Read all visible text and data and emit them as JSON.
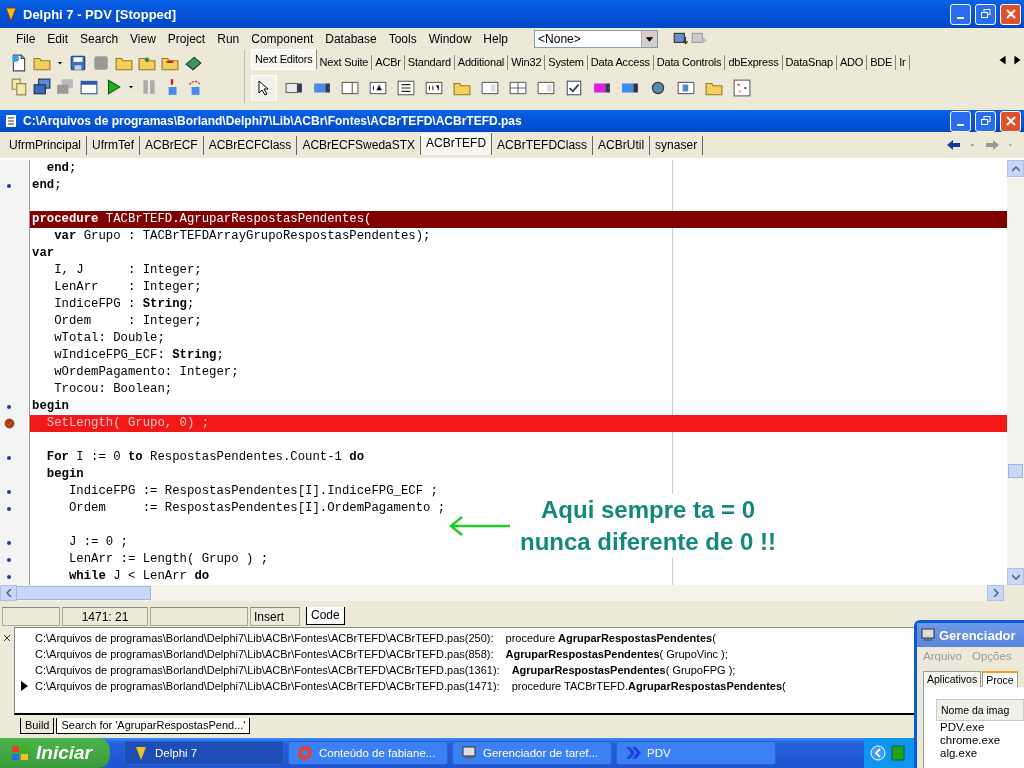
{
  "window": {
    "title": "Delphi 7 - PDV [Stopped]"
  },
  "menu": [
    "File",
    "Edit",
    "Search",
    "View",
    "Project",
    "Run",
    "Component",
    "Database",
    "Tools",
    "Window",
    "Help"
  ],
  "desktop_combo": {
    "value": "<None>"
  },
  "palette_tabs": [
    {
      "label": "Next Editors",
      "selected": true
    },
    {
      "label": "Next Suite",
      "selected": false
    },
    {
      "label": "ACBr",
      "selected": false
    },
    {
      "label": "Standard",
      "selected": false
    },
    {
      "label": "Additional",
      "selected": false
    },
    {
      "label": "Win32",
      "selected": false
    },
    {
      "label": "System",
      "selected": false
    },
    {
      "label": "Data Access",
      "selected": false
    },
    {
      "label": "Data Controls",
      "selected": false
    },
    {
      "label": "dbExpress",
      "selected": false
    },
    {
      "label": "DataSnap",
      "selected": false
    },
    {
      "label": "ADO",
      "selected": false
    },
    {
      "label": "BDE",
      "selected": false
    },
    {
      "label": "Ir",
      "selected": false
    }
  ],
  "editor": {
    "title": "C:\\Arquivos de programas\\Borland\\Delphi7\\Lib\\ACBr\\Fontes\\ACBrTEFD\\ACBrTEFD.pas",
    "tabs": [
      {
        "label": "UfrmPrincipal",
        "selected": false
      },
      {
        "label": "UfrmTef",
        "selected": false
      },
      {
        "label": "ACBrECF",
        "selected": false
      },
      {
        "label": "ACBrECFClass",
        "selected": false
      },
      {
        "label": "ACBrECFSwedaSTX",
        "selected": false
      },
      {
        "label": "ACBrTEFD",
        "selected": true
      },
      {
        "label": "ACBrTEFDClass",
        "selected": false
      },
      {
        "label": "ACBrUtil",
        "selected": false
      },
      {
        "label": "synaser",
        "selected": false
      }
    ],
    "lines": [
      {
        "kind": "plain",
        "text": "  **end**;",
        "dot": false
      },
      {
        "kind": "plain",
        "text": "**end**;",
        "dot": true
      },
      {
        "kind": "blank",
        "dot": false
      },
      {
        "kind": "search",
        "text": "**procedure** TACBrTEFD.AgruparRespostasPendentes(",
        "dot": false
      },
      {
        "kind": "plain",
        "text": "   **var** Grupo : TACBrTEFDArrayGrupoRespostasPendentes);",
        "dot": false
      },
      {
        "kind": "plain",
        "text": "**var**",
        "dot": false
      },
      {
        "kind": "plain",
        "text": "   I, J      : Integer;",
        "dot": false
      },
      {
        "kind": "plain",
        "text": "   LenArr    : Integer;",
        "dot": false
      },
      {
        "kind": "plain",
        "text": "   IndiceFPG : **String**;",
        "dot": false
      },
      {
        "kind": "plain",
        "text": "   Ordem     : Integer;",
        "dot": false
      },
      {
        "kind": "plain",
        "text": "   wTotal: Double;",
        "dot": false
      },
      {
        "kind": "plain",
        "text": "   wIndiceFPG_ECF: **String**;",
        "dot": false
      },
      {
        "kind": "plain",
        "text": "   wOrdemPagamento: Integer;",
        "dot": false
      },
      {
        "kind": "plain",
        "text": "   Trocou: Boolean;",
        "dot": false
      },
      {
        "kind": "plain",
        "text": "**begin**",
        "dot": true
      },
      {
        "kind": "breakpoint",
        "text": "  SetLength( Grupo, 0) ;",
        "dot": false
      },
      {
        "kind": "blank",
        "dot": false
      },
      {
        "kind": "plain",
        "text": "  **For** I := 0 **to** RespostasPendentes.Count-1 **do**",
        "dot": true
      },
      {
        "kind": "plain",
        "text": "  **begin**",
        "dot": false
      },
      {
        "kind": "plain",
        "text": "     IndiceFPG := RespostasPendentes[I].IndiceFPG_ECF ;",
        "dot": true
      },
      {
        "kind": "plain",
        "text": "     Ordem     := RespostasPendentes[I].OrdemPagamento ;",
        "dot": true
      },
      {
        "kind": "blank",
        "dot": false
      },
      {
        "kind": "plain",
        "text": "     J := 0 ;",
        "dot": true
      },
      {
        "kind": "plain",
        "text": "     LenArr := Length( Grupo ) ;",
        "dot": true
      },
      {
        "kind": "plain",
        "text": "     **while** J < LenArr **do**",
        "dot": true
      }
    ],
    "annotation": [
      "Aqui sempre ta = 0",
      "nunca diferente de 0 !!"
    ]
  },
  "status_bar": {
    "position": "1471:  21",
    "mode": "Insert",
    "tab": "Code"
  },
  "messages": {
    "rows": [
      {
        "location": "C:\\Arquivos de programas\\Borland\\Delphi7\\Lib\\ACBr\\Fontes\\ACBrTEFD\\ACBrTEFD.pas(250):",
        "match": "procedure **AgruparRespostasPendentes**(",
        "selected": false
      },
      {
        "location": "C:\\Arquivos de programas\\Borland\\Delphi7\\Lib\\ACBr\\Fontes\\ACBrTEFD\\ACBrTEFD.pas(858):",
        "match": "**AgruparRespostasPendentes**( GrupoVinc );",
        "selected": false
      },
      {
        "location": "C:\\Arquivos de programas\\Borland\\Delphi7\\Lib\\ACBr\\Fontes\\ACBrTEFD\\ACBrTEFD.pas(1361):",
        "match": "**AgruparRespostasPendentes**( GrupoFPG );",
        "selected": false
      },
      {
        "location": "C:\\Arquivos de programas\\Borland\\Delphi7\\Lib\\ACBr\\Fontes\\ACBrTEFD\\ACBrTEFD.pas(1471):",
        "match": "procedure TACBrTEFD.**AgruparRespostasPendentes**(",
        "selected": true
      }
    ],
    "tabs": [
      {
        "label": "Build",
        "selected": false
      },
      {
        "label": "Search for 'AgruparRespostasPend...'",
        "selected": true
      }
    ]
  },
  "taskbar": {
    "start": "Iniciar",
    "tasks": [
      {
        "label": "Delphi 7",
        "selected": true
      },
      {
        "label": "Conteúdo de fabiane...",
        "selected": false
      },
      {
        "label": "Gerenciador de taref...",
        "selected": false
      },
      {
        "label": "PDV",
        "selected": false
      }
    ]
  },
  "task_manager": {
    "title": "Gerenciador",
    "menu": [
      "Arquivo",
      "Opções"
    ],
    "tabs": [
      {
        "label": "Aplicativos",
        "selected": false
      },
      {
        "label": "Proce",
        "selected": true
      }
    ],
    "column": "Nome da imag",
    "rows": [
      "PDV.exe",
      "chrome.exe",
      "alg.exe"
    ]
  }
}
